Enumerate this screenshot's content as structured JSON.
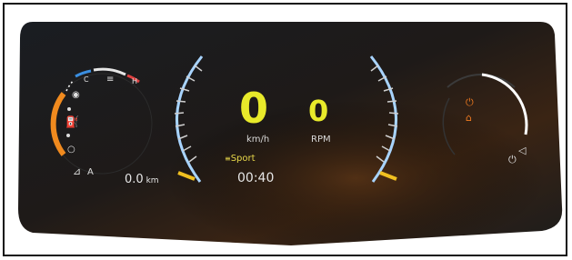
{
  "speedometer": {
    "value": "0",
    "unit": "km/h"
  },
  "tachometer": {
    "value": "0",
    "unit": "RPM"
  },
  "drive_mode": "Sport",
  "trip": {
    "value": "0.0",
    "unit": "km"
  },
  "clock": "00:40",
  "temperature_gauge": {
    "cold_label": "C",
    "hot_label": "H"
  },
  "indicators": {
    "auto_label": "A"
  },
  "colors": {
    "accent_yellow": "#e8ea2a",
    "fuel_orange": "#f08a1e",
    "arc_blue": "#a8d4ff",
    "hot_red": "#e04040",
    "cold_blue": "#3a8ee0",
    "power_orange": "#f07a20"
  },
  "icons": [
    "fuel-pump-icon",
    "engine-temp-icon",
    "power-icon",
    "home-icon",
    "warning-icon",
    "headlight-auto-icon",
    "eco-power-icon",
    "speaker-icon"
  ]
}
